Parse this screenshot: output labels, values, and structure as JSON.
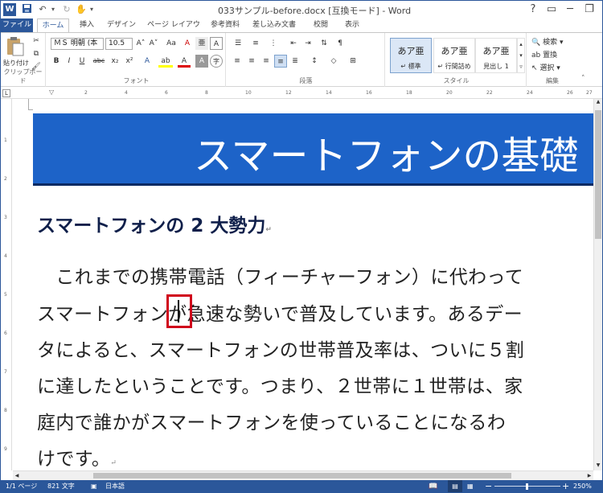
{
  "titlebar": {
    "title": "033サンプル-before.docx [互換モード] - Word",
    "app_icon": "W",
    "help": "?",
    "minimize": "─",
    "restore": "❐",
    "close": "✕"
  },
  "tabs": [
    "ファイル",
    "ホーム",
    "挿入",
    "デザイン",
    "ページ レイアウト",
    "参考資料",
    "差し込み文書",
    "校閲",
    "表示"
  ],
  "ribbon": {
    "clipboard": {
      "paste": "貼り付け",
      "label": "クリップボード"
    },
    "font": {
      "name": "ＭＳ 明朝 (本",
      "size": "10.5",
      "label": "フォント",
      "grow": "A˄",
      "shrink": "A˅",
      "case": "Aa",
      "clear": "A",
      "bold": "B",
      "italic": "I",
      "underline": "U",
      "strike": "abc",
      "sub": "x₂",
      "sup": "x²",
      "effect": "A",
      "highlight": "ab",
      "color": "A",
      "border": "A"
    },
    "paragraph": {
      "label": "段落"
    },
    "styles": {
      "label": "スタイル",
      "items": [
        {
          "sample": "あア亜",
          "name": "↵ 標準"
        },
        {
          "sample": "あア亜",
          "name": "↵ 行間詰め"
        },
        {
          "sample": "あア亜",
          "name": "見出し 1"
        }
      ]
    },
    "editing": {
      "find": "検索",
      "replace": "置換",
      "select": "選択",
      "label": "編集"
    }
  },
  "ruler": {
    "h_ticks": [
      "2",
      "4",
      "6",
      "8",
      "10",
      "12",
      "14",
      "16",
      "18",
      "20",
      "22",
      "24",
      "26",
      "27"
    ]
  },
  "document": {
    "banner_title": "スマートフォンの基礎",
    "heading": "スマートフォンの 2 大勢力",
    "heading_mark": "↵",
    "lines": [
      "　これまでの携帯電話（フィーチャーフォン）に代わって",
      "スマートフォンが急速な勢いで普及しています。あるデー",
      "タによると、スマートフォンの世帯普及率は、ついに５割",
      "に達したということです。つまり、２世帯に１世帯は、家",
      "庭内で誰かがスマートフォンを使っていることになるわ",
      "けです。"
    ],
    "end_mark": "↵"
  },
  "status": {
    "page": "1/1 ページ",
    "words": "821 文字",
    "lang": "日本語",
    "zoom": "250%",
    "zoom_minus": "−",
    "zoom_plus": "+"
  },
  "colors": {
    "accent": "#2b579a",
    "banner": "#1d63c8",
    "highlight": "#d0021b"
  }
}
